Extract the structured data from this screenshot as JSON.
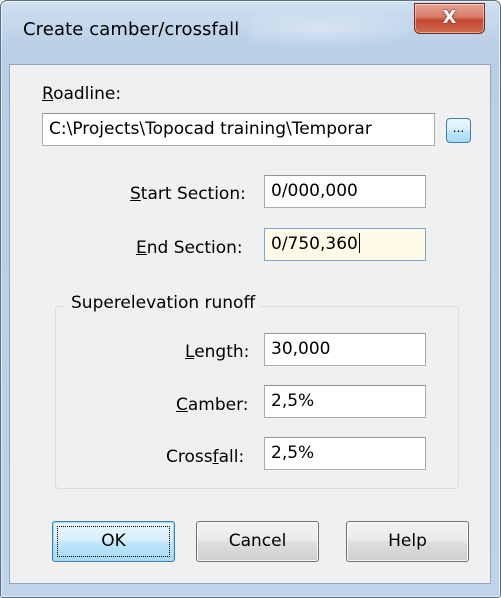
{
  "window": {
    "title": "Create camber/crossfall",
    "close_glyph": "X"
  },
  "roadline": {
    "label_accel": "R",
    "label_rest": "oadline:",
    "value": "C:\\Projects\\Topocad training\\Temporar",
    "browse_label": "..."
  },
  "start_section": {
    "label_accel": "S",
    "label_rest": "tart Section:",
    "value": "0/000,000"
  },
  "end_section": {
    "label_accel": "E",
    "label_rest": "nd Section:",
    "value": "0/750,360"
  },
  "superelevation": {
    "group_title": "Superelevation runoff",
    "length": {
      "label_accel": "L",
      "label_rest": "ength:",
      "value": "30,000"
    },
    "camber": {
      "label_accel": "C",
      "label_rest": "amber:",
      "value": "2,5%"
    },
    "crossfall": {
      "label_pre": "Cross",
      "label_accel": "f",
      "label_rest": "all:",
      "value": "2,5%"
    }
  },
  "buttons": {
    "ok": "OK",
    "cancel": "Cancel",
    "help": "Help"
  },
  "colors": {
    "frame": "#bcd1e8",
    "client": "#f0f0f0",
    "close_button": "#c34a30",
    "default_button": "#bee6fd",
    "focused_field": "#fffbe8"
  }
}
